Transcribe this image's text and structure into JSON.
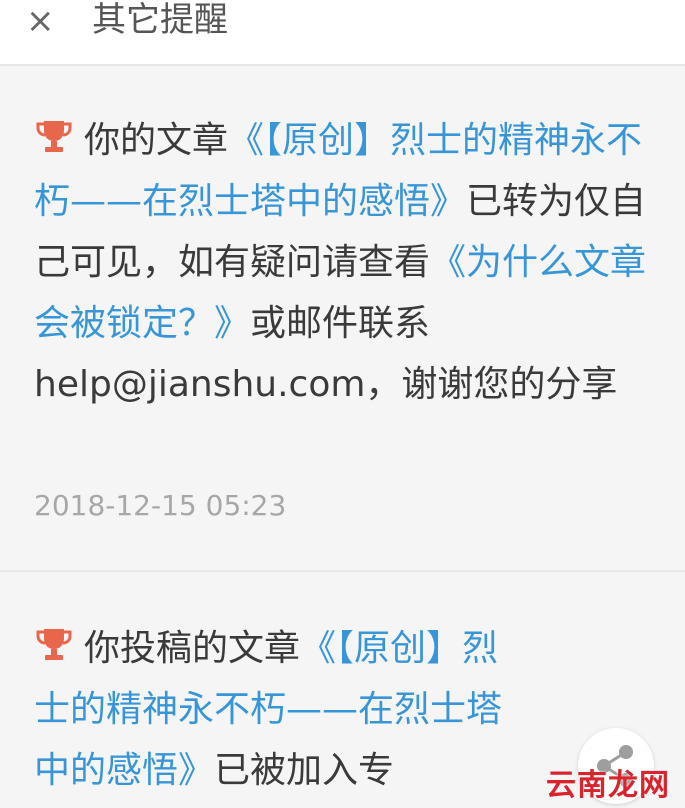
{
  "header": {
    "close_glyph": "×",
    "title": "其它提醒"
  },
  "notices": [
    {
      "icon": "trophy-icon",
      "prefix": "你的文章",
      "article_link": "《【原创】烈士的精神永不朽——在烈士塔中的感悟》",
      "middle": "已转为仅自己可见，如有疑问请查看",
      "help_link": "《为什么文章会被锁定？》",
      "suffix": "或邮件联系 help@jianshu.com，谢谢您的分享",
      "timestamp": "2018-12-15 05:23"
    },
    {
      "icon": "trophy-icon",
      "prefix": "你投稿的文章",
      "article_link": "《【原创】烈士的精神永不朽——在烈士塔中的感悟》",
      "suffix": "已被加入专"
    }
  ],
  "watermark": "云南龙网",
  "colors": {
    "link": "#3896d8",
    "trophy": "#e8664c",
    "text": "#3a3a3a",
    "timestamp": "#a7a7a7"
  }
}
